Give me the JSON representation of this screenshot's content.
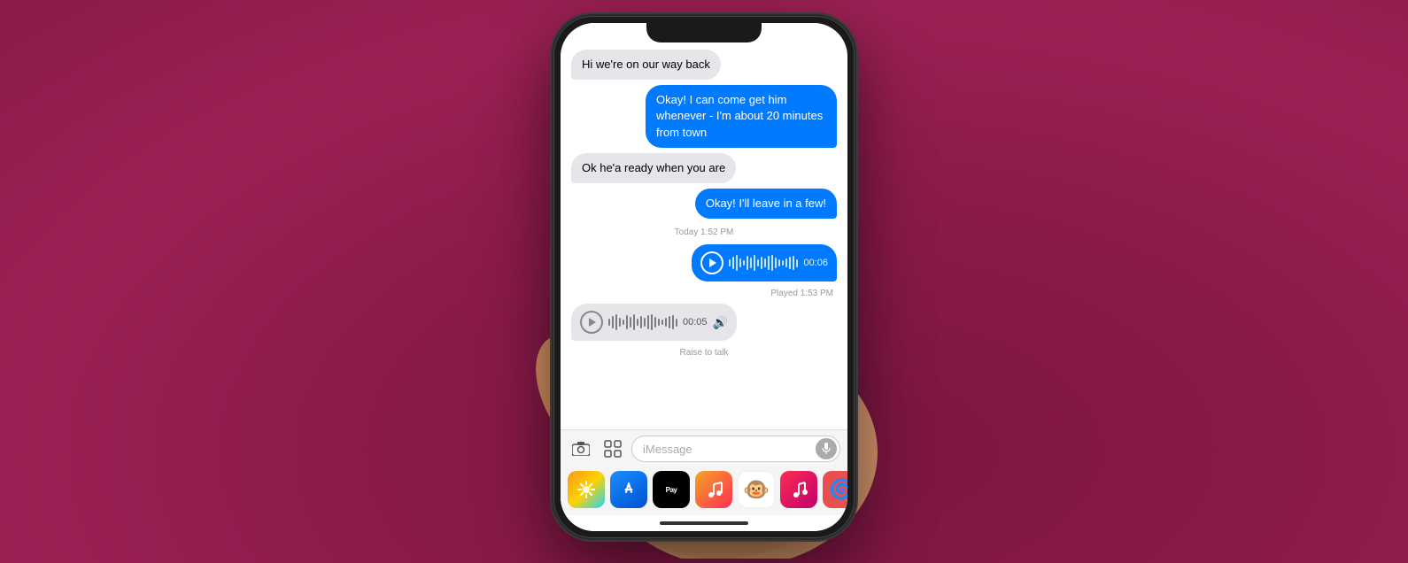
{
  "background": {
    "color": "#8B1A4A"
  },
  "messages": [
    {
      "id": "msg1",
      "type": "received",
      "text": "Hi we're on our way back"
    },
    {
      "id": "msg2",
      "type": "sent",
      "text": "Okay! I can come get him whenever - I'm about 20 minutes from town"
    },
    {
      "id": "msg3",
      "type": "received",
      "text": "Ok he'a ready when you are"
    },
    {
      "id": "msg4",
      "type": "sent",
      "text": "Okay! I'll leave in a few!"
    },
    {
      "id": "msg5",
      "type": "timestamp",
      "text": "Today 1:52 PM"
    },
    {
      "id": "msg6",
      "type": "audio-sent",
      "duration": "00:06"
    },
    {
      "id": "msg7",
      "type": "played-label",
      "text": "Played 1:53 PM"
    },
    {
      "id": "msg8",
      "type": "audio-received",
      "duration": "00:05"
    },
    {
      "id": "msg9",
      "type": "raise-to-talk",
      "text": "Raise to talk"
    }
  ],
  "input": {
    "placeholder": "iMessage"
  },
  "app_icons": [
    {
      "name": "Photos",
      "emoji": "🖼️",
      "bg": "#f5a623"
    },
    {
      "name": "App Store",
      "emoji": "🅰",
      "bg": "#0a7dff"
    },
    {
      "name": "Apple Pay",
      "label": "Pay",
      "bg": "#000"
    },
    {
      "name": "Music",
      "emoji": "🎵",
      "bg": "#ff2d55"
    },
    {
      "name": "Bitmoji",
      "emoji": "🐵",
      "bg": "#fff"
    },
    {
      "name": "Music2",
      "emoji": "🎵",
      "bg": "#ff2d55"
    },
    {
      "name": "Custom",
      "emoji": "🌀",
      "bg": "#e94f4f"
    }
  ]
}
